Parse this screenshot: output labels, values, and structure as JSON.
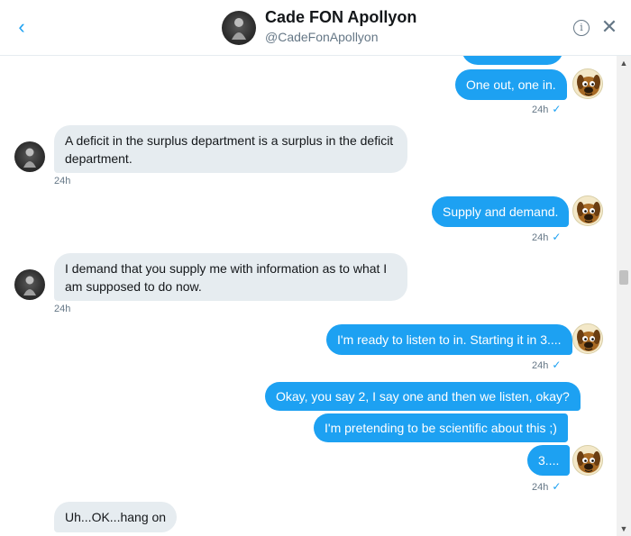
{
  "header": {
    "back_icon": "‹",
    "name": "Cade FON Apollyon",
    "handle": "@CadeFonApollyon",
    "info_icon": "i",
    "close_icon": "✕"
  },
  "messages": [
    {
      "direction": "sent",
      "text": "One out, one in.",
      "time": "24h",
      "seen_icon": "✓"
    },
    {
      "direction": "received",
      "text": "A deficit in the surplus department is a surplus in the deficit department.",
      "time": "24h"
    },
    {
      "direction": "sent",
      "text": "Supply and demand.",
      "time": "24h",
      "seen_icon": "✓"
    },
    {
      "direction": "received",
      "text": "I demand that you supply me with information as to what I am supposed to do now.",
      "time": "24h"
    },
    {
      "direction": "sent",
      "text": "I'm ready to listen to in. Starting it in 3....",
      "time": "24h",
      "seen_icon": "✓"
    },
    {
      "direction": "sent",
      "text": "Okay, you say 2, I say one and then we listen, okay?"
    },
    {
      "direction": "sent",
      "text": "I'm pretending to be scientific about this ;)"
    },
    {
      "direction": "sent",
      "text": "3....",
      "time": "24h",
      "seen_icon": "✓"
    },
    {
      "direction": "received",
      "text": "Uh...OK...hang on"
    }
  ],
  "scrollbar": {
    "up_icon": "▲",
    "down_icon": "▼"
  },
  "colors": {
    "accent": "#1da1f2",
    "received_bg": "#e6ecf0",
    "muted": "#657786"
  }
}
